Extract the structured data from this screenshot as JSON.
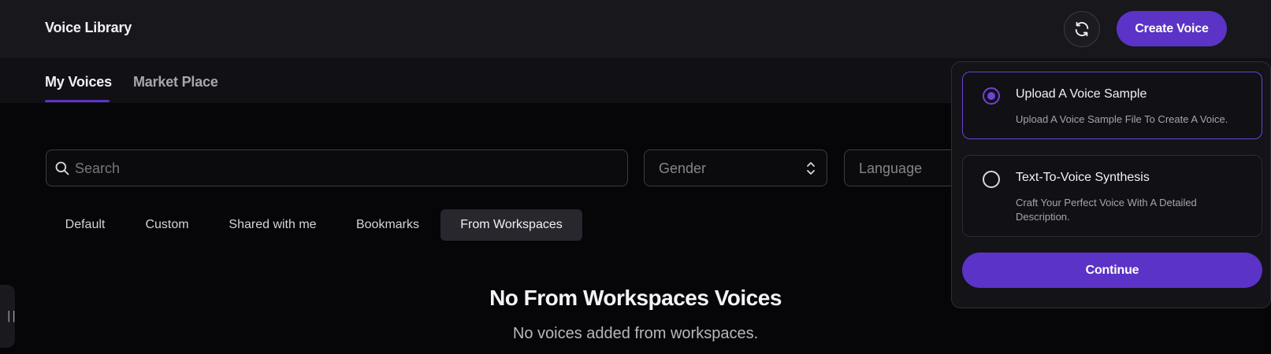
{
  "header": {
    "title": "Voice Library",
    "refresh_icon": "refresh-icon",
    "create_button": "Create Voice"
  },
  "tabs": [
    {
      "label": "My Voices",
      "active": true
    },
    {
      "label": "Market Place",
      "active": false
    }
  ],
  "filters": {
    "search_placeholder": "Search",
    "search_icon": "search-icon",
    "gender_label": "Gender",
    "language_label": "Language"
  },
  "categories": [
    {
      "label": "Default",
      "selected": false
    },
    {
      "label": "Custom",
      "selected": false
    },
    {
      "label": "Shared with me",
      "selected": false
    },
    {
      "label": "Bookmarks",
      "selected": false
    },
    {
      "label": "From Workspaces",
      "selected": true
    }
  ],
  "empty_state": {
    "title": "No From Workspaces Voices",
    "subtitle": "No voices added from workspaces."
  },
  "create_menu": {
    "options": [
      {
        "title": "Upload A Voice Sample",
        "description": "Upload A Voice Sample File To Create A Voice.",
        "selected": true
      },
      {
        "title": "Text-To-Voice Synthesis",
        "description": "Craft Your Perfect Voice With A Detailed Description.",
        "selected": false
      }
    ],
    "continue_button": "Continue"
  },
  "colors": {
    "accent": "#5b33c6",
    "background": "#060608",
    "header_bg": "#18171c"
  }
}
